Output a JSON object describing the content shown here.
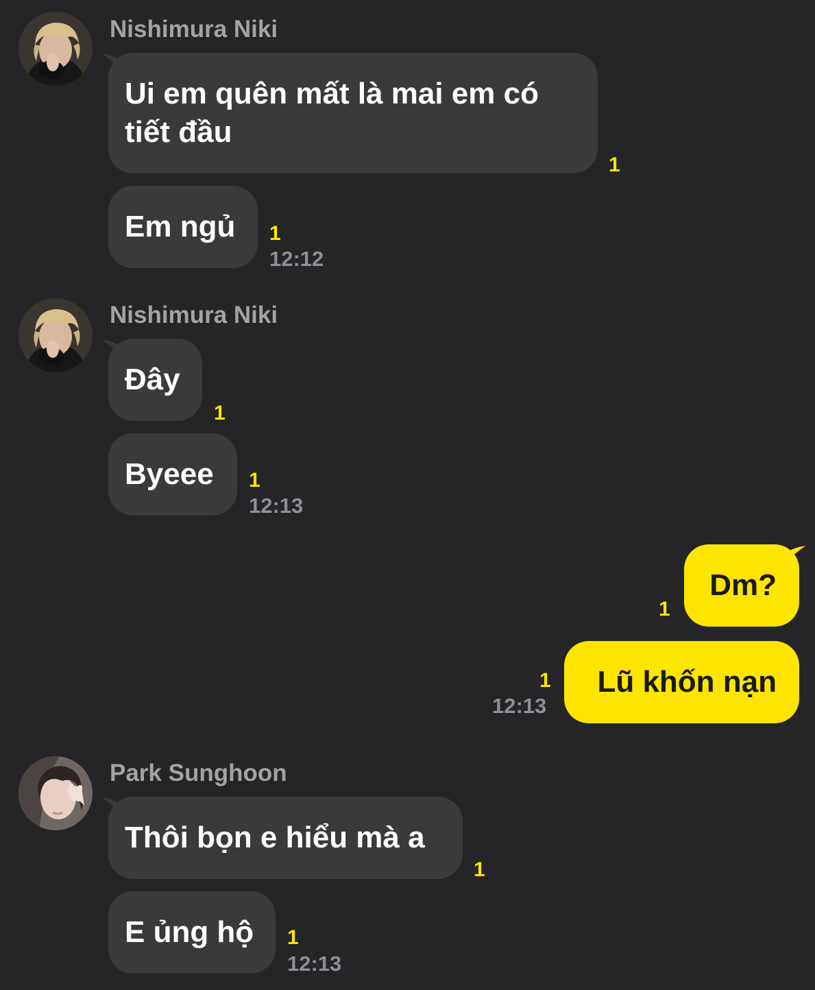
{
  "senders": {
    "niki": "Nishimura Niki",
    "sunghoon": "Park Sunghoon"
  },
  "avatars": {
    "niki": "avatar-niki",
    "sunghoon": "avatar-sunghoon"
  },
  "group1": {
    "sender": "Nishimura Niki",
    "messages": [
      {
        "text": "Ui em quên mất là mai em có tiết đầu",
        "unread": "1"
      },
      {
        "text": "Em ngủ",
        "unread": "1",
        "time": "12:12"
      }
    ]
  },
  "group2": {
    "sender": "Nishimura Niki",
    "messages": [
      {
        "text": "Đây",
        "unread": "1"
      },
      {
        "text": "Byeee",
        "unread": "1",
        "time": "12:13"
      }
    ]
  },
  "group3": {
    "messages": [
      {
        "text": "Dm?",
        "unread": "1"
      },
      {
        "text": "Lũ khốn nạn",
        "unread": "1",
        "time": "12:13"
      }
    ]
  },
  "group4": {
    "sender": "Park Sunghoon",
    "messages": [
      {
        "text": "Thôi bọn e hiểu mà a",
        "unread": "1"
      },
      {
        "text": "E ủng hộ",
        "unread": "1",
        "time": "12:13"
      }
    ]
  },
  "colors": {
    "background": "#252527",
    "incoming_bubble": "#3a3a3c",
    "outgoing_bubble": "#fee500",
    "unread": "#fee500",
    "meta_text": "#8e8e93"
  }
}
